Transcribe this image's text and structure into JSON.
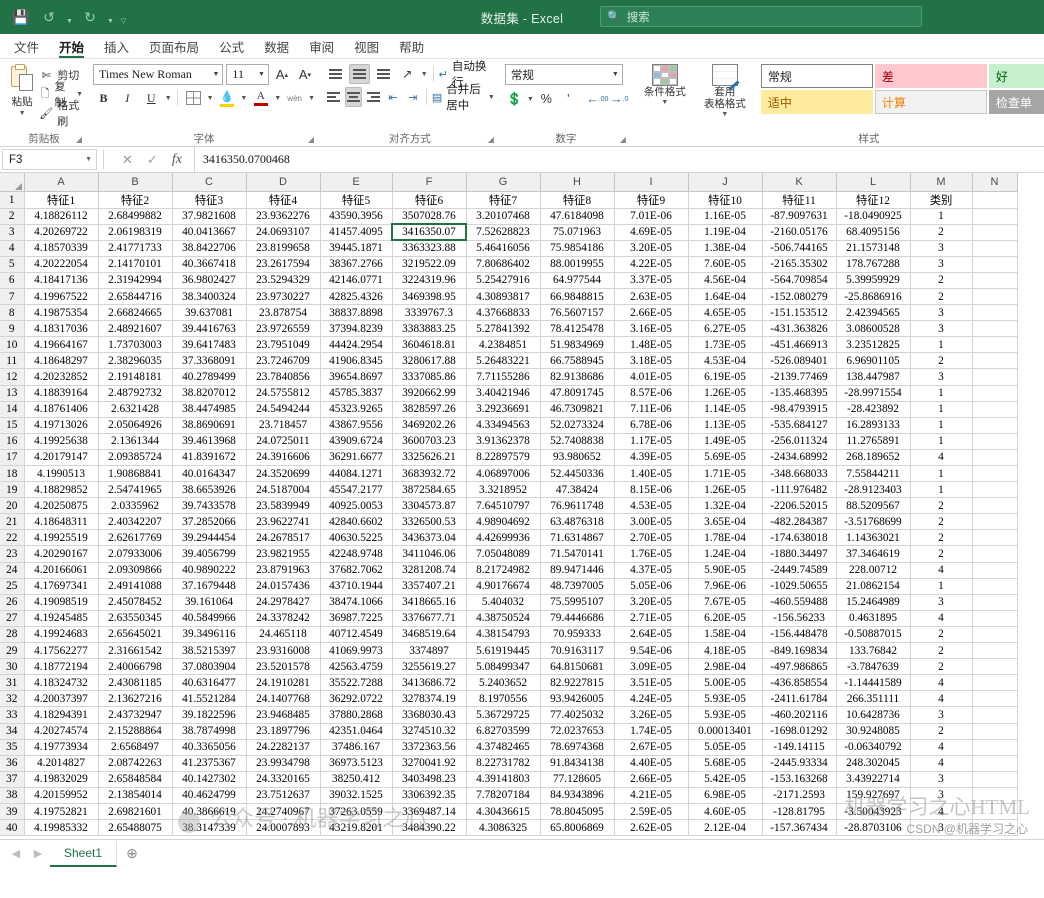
{
  "window": {
    "title": "数据集 - Excel",
    "quick_access": [
      "save-icon",
      "undo-icon",
      "redo-icon",
      "customize-icon"
    ],
    "search_placeholder": "搜索",
    "search_icon": "search-icon"
  },
  "ribbon": {
    "tabs": [
      {
        "label": "文件",
        "active": false
      },
      {
        "label": "开始",
        "active": true
      },
      {
        "label": "插入",
        "active": false
      },
      {
        "label": "页面布局",
        "active": false
      },
      {
        "label": "公式",
        "active": false
      },
      {
        "label": "数据",
        "active": false
      },
      {
        "label": "审阅",
        "active": false
      },
      {
        "label": "视图",
        "active": false
      },
      {
        "label": "帮助",
        "active": false
      }
    ],
    "clipboard": {
      "group_label": "剪贴板",
      "paste_label": "粘贴",
      "cut_label": "剪切",
      "copy_label": "复制",
      "format_painter_label": "格式刷"
    },
    "font": {
      "group_label": "字体",
      "font_name": "Times New Roman",
      "font_size": "11",
      "grow_font": "A",
      "shrink_font": "A",
      "bold": "B",
      "italic": "I",
      "underline": "U",
      "borders_icon": "borders-icon",
      "fill_color": "A",
      "font_color": "A",
      "phonetic": "wén"
    },
    "alignment": {
      "group_label": "对齐方式",
      "wrap_text_label": "自动换行",
      "merge_center_label": "合并后居中",
      "orientation_icon": "text-orientation-icon"
    },
    "number": {
      "group_label": "数字",
      "format_value": "常规",
      "percent": "%",
      "comma": "’",
      "increase_decimal": ".00",
      "decrease_decimal": ".00"
    },
    "styles": {
      "group_label": "样式",
      "conditional_format_label": "条件格式",
      "table_format_label": "套用\n表格格式",
      "cell_styles": [
        {
          "label": "常规",
          "kind": "normal"
        },
        {
          "label": "差",
          "kind": "bad"
        },
        {
          "label": "好",
          "kind": "good"
        },
        {
          "label": "适中",
          "kind": "neutral"
        },
        {
          "label": "计算",
          "kind": "calc"
        },
        {
          "label": "检查单",
          "kind": "check"
        }
      ]
    }
  },
  "formula_bar": {
    "name_box": "F3",
    "cancel_icon": "close-icon",
    "confirm_icon": "check-icon",
    "function_icon": "fx-icon",
    "value": "3416350.0700468"
  },
  "grid": {
    "column_letters": [
      "A",
      "B",
      "C",
      "D",
      "E",
      "F",
      "G",
      "H",
      "I",
      "J",
      "K",
      "L",
      "M",
      "N"
    ],
    "selected_cell": "F3",
    "row_numbers": [
      1,
      2,
      3,
      4,
      5,
      6,
      7,
      8,
      9,
      10,
      11,
      12,
      13,
      14,
      15,
      16,
      17,
      18,
      19,
      20,
      21,
      22,
      23,
      24,
      25,
      26,
      27,
      28,
      29,
      30,
      31,
      32,
      33,
      34,
      35,
      36,
      37,
      38,
      39,
      40
    ],
    "headers": [
      "特征1",
      "特征2",
      "特征3",
      "特征4",
      "特征5",
      "特征6",
      "特征7",
      "特征8",
      "特征9",
      "特征10",
      "特征11",
      "特征12",
      "类别",
      ""
    ],
    "rows": [
      [
        "4.18826112",
        "2.68499882",
        "37.9821608",
        "23.9362276",
        "43590.3956",
        "3507028.76",
        "3.20107468",
        "47.6184098",
        "7.01E-06",
        "1.16E-05",
        "-87.9097631",
        "-18.0490925",
        "1",
        ""
      ],
      [
        "4.20269722",
        "2.06198319",
        "40.0413667",
        "24.0693107",
        "41457.4095",
        "3416350.07",
        "7.52628823",
        "75.071963",
        "4.69E-05",
        "1.19E-04",
        "-2160.05176",
        "68.4095156",
        "2",
        ""
      ],
      [
        "4.18570339",
        "2.41771733",
        "38.8422706",
        "23.8199658",
        "39445.1871",
        "3363323.88",
        "5.46416056",
        "75.9854186",
        "3.20E-05",
        "1.38E-04",
        "-506.744165",
        "21.1573148",
        "3",
        ""
      ],
      [
        "4.20222054",
        "2.14170101",
        "40.3667418",
        "23.2617594",
        "38367.2766",
        "3219522.09",
        "7.80686402",
        "88.0019955",
        "4.22E-05",
        "7.60E-05",
        "-2165.35302",
        "178.767288",
        "3",
        ""
      ],
      [
        "4.18417136",
        "2.31942994",
        "36.9802427",
        "23.5294329",
        "42146.0771",
        "3224319.96",
        "5.25427916",
        "64.977544",
        "3.37E-05",
        "4.56E-04",
        "-564.709854",
        "5.39959929",
        "2",
        ""
      ],
      [
        "4.19967522",
        "2.65844716",
        "38.3400324",
        "23.9730227",
        "42825.4326",
        "3469398.95",
        "4.30893817",
        "66.9848815",
        "2.63E-05",
        "1.64E-04",
        "-152.080279",
        "-25.8686916",
        "2",
        ""
      ],
      [
        "4.19875354",
        "2.66824665",
        "39.637081",
        "23.878754",
        "38837.8898",
        "3339767.3",
        "4.37668833",
        "76.5607157",
        "2.66E-05",
        "4.65E-05",
        "-151.153512",
        "2.42394565",
        "3",
        ""
      ],
      [
        "4.18317036",
        "2.48921607",
        "39.4416763",
        "23.9726559",
        "37394.8239",
        "3383883.25",
        "5.27841392",
        "78.4125478",
        "3.16E-05",
        "6.27E-05",
        "-431.363826",
        "3.08600528",
        "3",
        ""
      ],
      [
        "4.19664167",
        "1.73703003",
        "39.6417483",
        "23.7951049",
        "44424.2954",
        "3604618.81",
        "4.2384851",
        "51.9834969",
        "1.48E-05",
        "1.73E-05",
        "-451.466913",
        "3.23512825",
        "1",
        ""
      ],
      [
        "4.18648297",
        "2.38296035",
        "37.3368091",
        "23.7246709",
        "41906.8345",
        "3280617.88",
        "5.26483221",
        "66.7588945",
        "3.18E-05",
        "4.53E-04",
        "-526.089401",
        "6.96901105",
        "2",
        ""
      ],
      [
        "4.20232852",
        "2.19148181",
        "40.2789499",
        "23.7840856",
        "39654.8697",
        "3337085.86",
        "7.71155286",
        "82.9138686",
        "4.01E-05",
        "6.19E-05",
        "-2139.77469",
        "138.447987",
        "3",
        ""
      ],
      [
        "4.18839164",
        "2.48792732",
        "38.8207012",
        "24.5755812",
        "45785.3837",
        "3920662.99",
        "3.40421946",
        "47.8091745",
        "8.57E-06",
        "1.26E-05",
        "-135.468395",
        "-28.9971554",
        "1",
        ""
      ],
      [
        "4.18761406",
        "2.6321428",
        "38.4474985",
        "24.5494244",
        "45323.9265",
        "3828597.26",
        "3.29236691",
        "46.7309821",
        "7.11E-06",
        "1.14E-05",
        "-98.4793915",
        "-28.423892",
        "1",
        ""
      ],
      [
        "4.19713026",
        "2.05064926",
        "38.8690691",
        "23.718457",
        "43867.9556",
        "3469202.26",
        "4.33494563",
        "52.0273324",
        "6.78E-06",
        "1.13E-05",
        "-535.684127",
        "16.2893133",
        "1",
        ""
      ],
      [
        "4.19925638",
        "2.1361344",
        "39.4613968",
        "24.0725011",
        "43909.6724",
        "3600703.23",
        "3.91362378",
        "52.7408838",
        "1.17E-05",
        "1.49E-05",
        "-256.011324",
        "11.2765891",
        "1",
        ""
      ],
      [
        "4.20179147",
        "2.09385724",
        "41.8391672",
        "24.3916606",
        "36291.6677",
        "3325626.21",
        "8.22897579",
        "93.980652",
        "4.39E-05",
        "5.69E-05",
        "-2434.68992",
        "268.189652",
        "4",
        ""
      ],
      [
        "4.1990513",
        "1.90868841",
        "40.0164347",
        "24.3520699",
        "44084.1271",
        "3683932.72",
        "4.06897006",
        "52.4450336",
        "1.40E-05",
        "1.71E-05",
        "-348.668033",
        "7.55844211",
        "1",
        ""
      ],
      [
        "4.18829852",
        "2.54741965",
        "38.6653926",
        "24.5187004",
        "45547.2177",
        "3872584.65",
        "3.3218952",
        "47.38424",
        "8.15E-06",
        "1.26E-05",
        "-111.976482",
        "-28.9123403",
        "1",
        ""
      ],
      [
        "4.20250875",
        "2.0335962",
        "39.7433578",
        "23.5839949",
        "40925.0053",
        "3304573.87",
        "7.64510797",
        "76.9611748",
        "4.53E-05",
        "1.32E-04",
        "-2206.52015",
        "88.5209567",
        "2",
        ""
      ],
      [
        "4.18648311",
        "2.40342207",
        "37.2852066",
        "23.9622741",
        "42840.6602",
        "3326500.53",
        "4.98904692",
        "63.4876318",
        "3.00E-05",
        "3.65E-04",
        "-482.284387",
        "-3.51768699",
        "2",
        ""
      ],
      [
        "4.19925519",
        "2.62617769",
        "39.2944454",
        "24.2678517",
        "40630.5225",
        "3436373.04",
        "4.42699936",
        "71.6314867",
        "2.70E-05",
        "1.78E-04",
        "-174.638018",
        "1.14363021",
        "2",
        ""
      ],
      [
        "4.20290167",
        "2.07933006",
        "39.4056799",
        "23.9821955",
        "42248.9748",
        "3411046.06",
        "7.05048089",
        "71.5470141",
        "1.76E-05",
        "1.24E-04",
        "-1880.34497",
        "37.3464619",
        "2",
        ""
      ],
      [
        "4.20166061",
        "2.09309866",
        "40.9890222",
        "23.8791963",
        "37682.7062",
        "3281208.74",
        "8.21724982",
        "89.9471446",
        "4.37E-05",
        "5.90E-05",
        "-2449.74589",
        "228.00712",
        "4",
        ""
      ],
      [
        "4.17697341",
        "2.49141088",
        "37.1679448",
        "24.0157436",
        "43710.1944",
        "3357407.21",
        "4.90176674",
        "48.7397005",
        "5.05E-06",
        "7.96E-06",
        "-1029.50655",
        "21.0862154",
        "1",
        ""
      ],
      [
        "4.19098519",
        "2.45078452",
        "39.161064",
        "24.2978427",
        "38474.1066",
        "3418665.16",
        "5.404032",
        "75.5995107",
        "3.20E-05",
        "7.67E-05",
        "-460.559488",
        "15.2464989",
        "3",
        ""
      ],
      [
        "4.19245485",
        "2.63550345",
        "40.5849966",
        "24.3378242",
        "36987.7225",
        "3376677.71",
        "4.38750524",
        "79.4446686",
        "2.71E-05",
        "6.20E-05",
        "-156.56233",
        "0.4631895",
        "4",
        ""
      ],
      [
        "4.19924683",
        "2.65645021",
        "39.3496116",
        "24.465118",
        "40712.4549",
        "3468519.64",
        "4.38154793",
        "70.959333",
        "2.64E-05",
        "1.58E-04",
        "-156.448478",
        "-0.50887015",
        "2",
        ""
      ],
      [
        "4.17562277",
        "2.31661542",
        "38.5215397",
        "23.9316008",
        "41069.9973",
        "3374897",
        "5.61919445",
        "70.9163117",
        "9.54E-06",
        "4.18E-05",
        "-849.169834",
        "133.76842",
        "2",
        ""
      ],
      [
        "4.18772194",
        "2.40066798",
        "37.0803904",
        "23.5201578",
        "42563.4759",
        "3255619.27",
        "5.08499347",
        "64.8150681",
        "3.09E-05",
        "2.98E-04",
        "-497.986865",
        "-3.7847639",
        "2",
        ""
      ],
      [
        "4.18324732",
        "2.43081185",
        "40.6316477",
        "24.1910281",
        "35522.7288",
        "3413686.72",
        "5.2403652",
        "82.9227815",
        "3.51E-05",
        "5.00E-05",
        "-436.858554",
        "-1.14441589",
        "4",
        ""
      ],
      [
        "4.20037397",
        "2.13627216",
        "41.5521284",
        "24.1407768",
        "36292.0722",
        "3278374.19",
        "8.1970556",
        "93.9426005",
        "4.24E-05",
        "5.93E-05",
        "-2411.61784",
        "266.351111",
        "4",
        ""
      ],
      [
        "4.18294391",
        "2.43732947",
        "39.1822596",
        "23.9468485",
        "37880.2868",
        "3368030.43",
        "5.36729725",
        "77.4025032",
        "3.26E-05",
        "5.93E-05",
        "-460.202116",
        "10.6428736",
        "3",
        ""
      ],
      [
        "4.20274574",
        "2.15288864",
        "38.7874998",
        "23.1897796",
        "42351.0464",
        "3274510.32",
        "6.82703599",
        "72.0237653",
        "1.74E-05",
        "0.00013401",
        "-1698.01292",
        "30.9248085",
        "2",
        ""
      ],
      [
        "4.19773934",
        "2.6568497",
        "40.3365056",
        "24.2282137",
        "37486.167",
        "3372363.56",
        "4.37482465",
        "78.6974368",
        "2.67E-05",
        "5.05E-05",
        "-149.14115",
        "-0.06340792",
        "4",
        ""
      ],
      [
        "4.2014827",
        "2.08742263",
        "41.2375367",
        "23.9934798",
        "36973.5123",
        "3270041.92",
        "8.22731782",
        "91.8434138",
        "4.40E-05",
        "5.68E-05",
        "-2445.93334",
        "248.302045",
        "4",
        ""
      ],
      [
        "4.19832029",
        "2.65848584",
        "40.1427302",
        "24.3320165",
        "38250.412",
        "3403498.23",
        "4.39141803",
        "77.128605",
        "2.66E-05",
        "5.42E-05",
        "-153.163268",
        "3.43922714",
        "3",
        ""
      ],
      [
        "4.20159952",
        "2.13854014",
        "40.4624799",
        "23.7512637",
        "39032.1525",
        "3306392.35",
        "7.78207184",
        "84.9343896",
        "4.21E-05",
        "6.98E-05",
        "-2171.2593",
        "159.927697",
        "3",
        ""
      ],
      [
        "4.19752821",
        "2.69821601",
        "40.3866619",
        "24.2740967",
        "37263.0559",
        "3369487.14",
        "4.30436615",
        "78.8045095",
        "2.59E-05",
        "4.60E-05",
        "-128.81795",
        "-3.50043923",
        "4",
        ""
      ],
      [
        "4.19985332",
        "2.65488075",
        "38.3147339",
        "24.0007893",
        "43219.8201",
        "3484390.22",
        "4.3086325",
        "65.8006869",
        "2.62E-05",
        "2.12E-04",
        "-157.367434",
        "-28.8703106",
        "3",
        ""
      ]
    ]
  },
  "watermarks": {
    "main": "机器学习之心HTML",
    "secondary": "公众号 · 机器学习之心",
    "credit": "CSDN @机器学习之心"
  },
  "sheet_tabs": {
    "prev_icon": "chevron-left-icon",
    "next_icon": "chevron-right-icon",
    "tabs": [
      "Sheet1"
    ],
    "add_label": "+"
  }
}
